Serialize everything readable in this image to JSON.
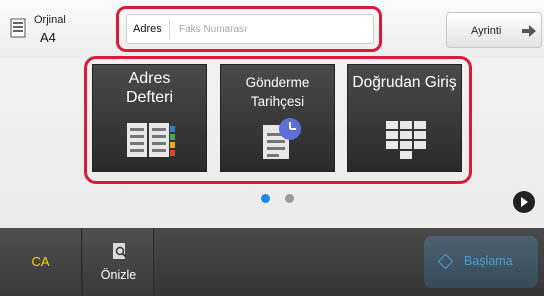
{
  "original": {
    "label": "Orjinal",
    "size": "A4"
  },
  "address": {
    "label": "Adres",
    "placeholder": "Faks Numarası"
  },
  "detail_button": {
    "label": "Ayrinti"
  },
  "tiles": [
    {
      "label_line1": "Adres",
      "label_line2": "Defteri",
      "icon": "address-book-icon"
    },
    {
      "label": "Gönderme Tarihçesi",
      "icon": "sending-history-icon"
    },
    {
      "label": "Doğrudan Giriş",
      "icon": "keypad-icon"
    }
  ],
  "pager": {
    "pages": 2,
    "current": 1
  },
  "bottom": {
    "ca_label": "CA",
    "preview_label": "Önizle",
    "start_label": "Başlama"
  },
  "colors": {
    "highlight": "#d81b3c",
    "ca_text": "#ffd200",
    "pager_active": "#1e88e5",
    "start_button": "#2e8fd6"
  }
}
